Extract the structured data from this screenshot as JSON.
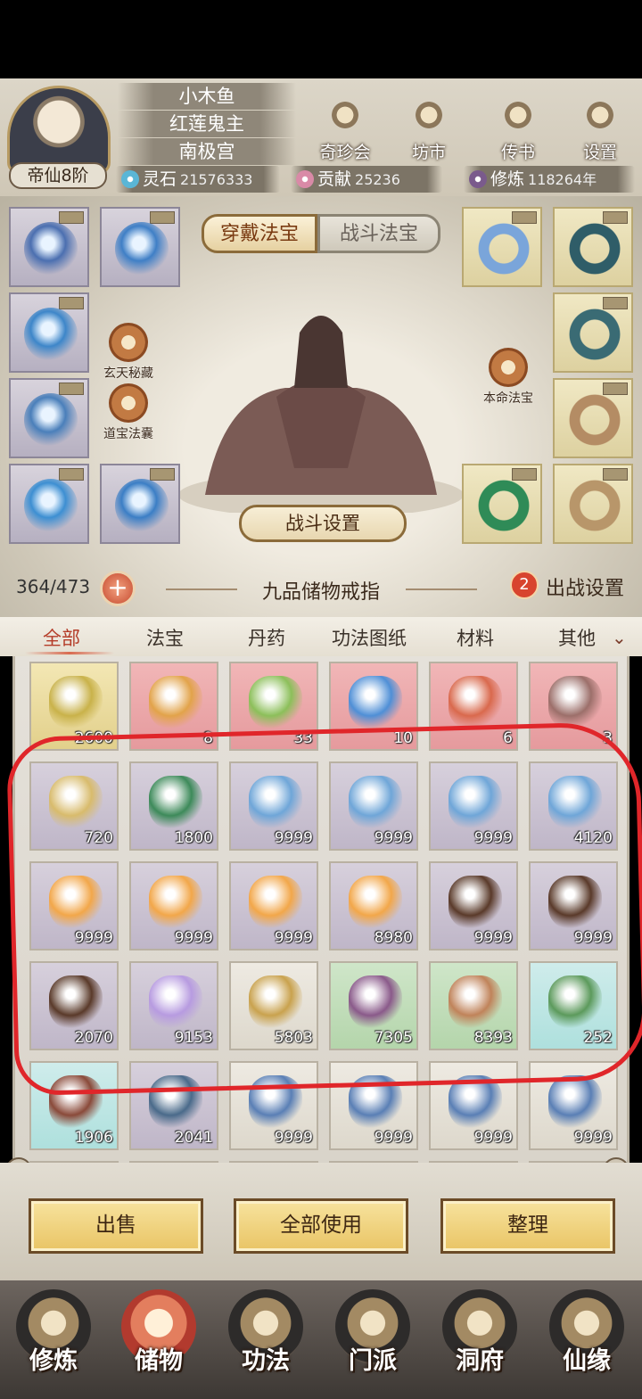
{
  "header": {
    "names": [
      "小木鱼",
      "红莲鬼主",
      "南极宫"
    ],
    "rank": "帝仙8阶",
    "top_buttons": [
      {
        "label": "奇珍会",
        "icon": "treasure-pavilion-icon"
      },
      {
        "label": "坊市",
        "icon": "market-icon"
      },
      {
        "label": "传书",
        "icon": "scroll-letter-icon"
      },
      {
        "label": "设置",
        "icon": "gear-icon"
      }
    ],
    "resources": [
      {
        "label": "灵石",
        "value": "21576333",
        "color": "#5ab6d6"
      },
      {
        "label": "贡献",
        "value": "25236",
        "color": "#d98aa7"
      },
      {
        "label": "修炼",
        "value": "118264年",
        "color": "#7a5a8c"
      }
    ]
  },
  "equip": {
    "tabs": [
      "穿戴法宝",
      "战斗法宝"
    ],
    "left_buttons": [
      "玄天秘藏",
      "道宝法囊"
    ],
    "right_button": "本命法宝",
    "battle_setting": "战斗设置",
    "left_slot_colors": [
      "#4b6fb0",
      "#3f7fc6",
      "#3d86c9",
      "#4a7fba",
      "#3d8fd2",
      "#3b7ec5"
    ],
    "right_slot_colors": [
      "#7aa5da",
      "#2f5d68",
      "#3a6b74",
      "#b48c64",
      "#2f8b57",
      "#b8966a"
    ]
  },
  "ring": {
    "capacity": "364/473",
    "title": "九品储物戒指",
    "sortie_count": "2",
    "sortie_label": "出战设置"
  },
  "categories": [
    "全部",
    "法宝",
    "丹药",
    "功法图纸",
    "材料",
    "其他"
  ],
  "items": [
    {
      "count": "2600",
      "bg": "gold",
      "color": "#c9b24a"
    },
    {
      "count": "8",
      "bg": "pink",
      "color": "#e2a34a"
    },
    {
      "count": "33",
      "bg": "pink",
      "color": "#8cbf5a"
    },
    {
      "count": "10",
      "bg": "pink",
      "color": "#4f8fd6"
    },
    {
      "count": "6",
      "bg": "pink",
      "color": "#d9694d"
    },
    {
      "count": "3",
      "bg": "pink",
      "color": "#9c6f6a"
    },
    {
      "count": "720",
      "bg": "purple",
      "color": "#d8bb6c"
    },
    {
      "count": "1800",
      "bg": "purple",
      "color": "#3d8a5a"
    },
    {
      "count": "9999",
      "bg": "purple",
      "color": "#6fa6d8"
    },
    {
      "count": "9999",
      "bg": "purple",
      "color": "#6fa6d8"
    },
    {
      "count": "9999",
      "bg": "purple",
      "color": "#6fa6d8"
    },
    {
      "count": "4120",
      "bg": "purple",
      "color": "#6fa6d8"
    },
    {
      "count": "9999",
      "bg": "purple",
      "color": "#f2a74a"
    },
    {
      "count": "9999",
      "bg": "purple",
      "color": "#f2a74a"
    },
    {
      "count": "9999",
      "bg": "purple",
      "color": "#f2a74a"
    },
    {
      "count": "8980",
      "bg": "purple",
      "color": "#f2a74a"
    },
    {
      "count": "9999",
      "bg": "purple",
      "color": "#5a3a2a"
    },
    {
      "count": "9999",
      "bg": "purple",
      "color": "#5a3a2a"
    },
    {
      "count": "2070",
      "bg": "purple",
      "color": "#5a3a2a"
    },
    {
      "count": "9153",
      "bg": "purple",
      "color": "#b79be0"
    },
    {
      "count": "5803",
      "bg": "white",
      "color": "#c9a24e"
    },
    {
      "count": "7305",
      "bg": "green",
      "color": "#8a5a8a"
    },
    {
      "count": "8393",
      "bg": "green",
      "color": "#c0835a"
    },
    {
      "count": "252",
      "bg": "cyan",
      "color": "#5c9a5c"
    },
    {
      "count": "1906",
      "bg": "cyan",
      "color": "#8a4a3a"
    },
    {
      "count": "2041",
      "bg": "purple",
      "color": "#4a6a8a"
    },
    {
      "count": "9999",
      "bg": "white",
      "color": "#5a7fb5"
    },
    {
      "count": "9999",
      "bg": "white",
      "color": "#5a7fb5"
    },
    {
      "count": "9999",
      "bg": "white",
      "color": "#5a7fb5"
    },
    {
      "count": "9999",
      "bg": "white",
      "color": "#5a7fb5"
    },
    {
      "count": "",
      "bg": "white",
      "color": "#d9d4ca"
    },
    {
      "count": "",
      "bg": "white",
      "color": "#d9d4ca"
    },
    {
      "count": "",
      "bg": "green",
      "color": "#cfe6c9"
    },
    {
      "count": "",
      "bg": "green",
      "color": "#cfe6c9"
    },
    {
      "count": "",
      "bg": "green",
      "color": "#cfe6c9"
    },
    {
      "count": "",
      "bg": "green",
      "color": "#cfe6c9"
    }
  ],
  "actions": [
    "出售",
    "全部使用",
    "整理"
  ],
  "nav": [
    {
      "label": "修炼",
      "icon": "cultivate-icon",
      "active": false
    },
    {
      "label": "储物",
      "icon": "storage-bag-icon",
      "active": true
    },
    {
      "label": "功法",
      "icon": "technique-scroll-icon",
      "active": false
    },
    {
      "label": "门派",
      "icon": "sect-gate-icon",
      "active": false
    },
    {
      "label": "洞府",
      "icon": "cave-dwelling-icon",
      "active": false
    },
    {
      "label": "仙缘",
      "icon": "immortal-fate-icon",
      "active": false
    }
  ],
  "annotation_color": "#e0262a"
}
